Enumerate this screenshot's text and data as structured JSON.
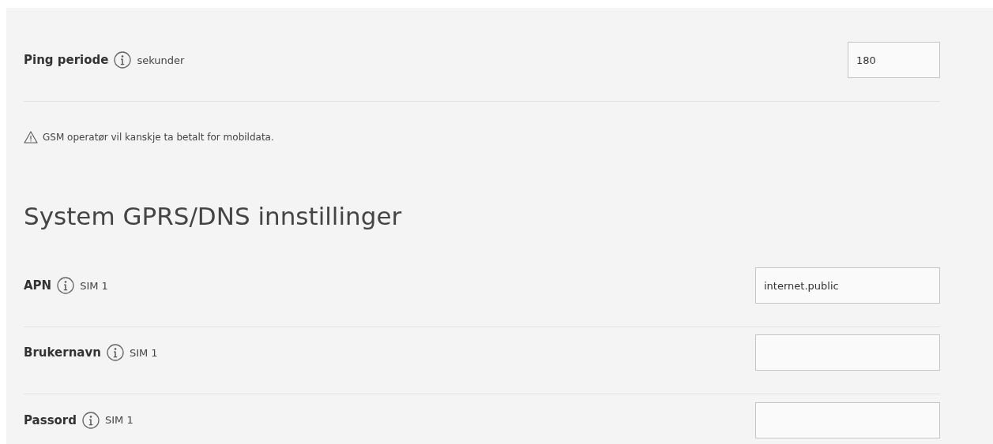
{
  "ping": {
    "label": "Ping periode",
    "unit": "sekunder",
    "kind": "number",
    "value": "180"
  },
  "warning": "GSM operatør vil kanskje ta betalt for mobildata.",
  "section_title": "System GPRS/DNS innstillinger",
  "fields": [
    {
      "label": "APN",
      "unit": "SIM 1",
      "value": "internet.public"
    },
    {
      "label": "Brukernavn",
      "unit": "SIM 1"
    },
    {
      "label": "Passord",
      "unit": "SIM 1"
    }
  ]
}
